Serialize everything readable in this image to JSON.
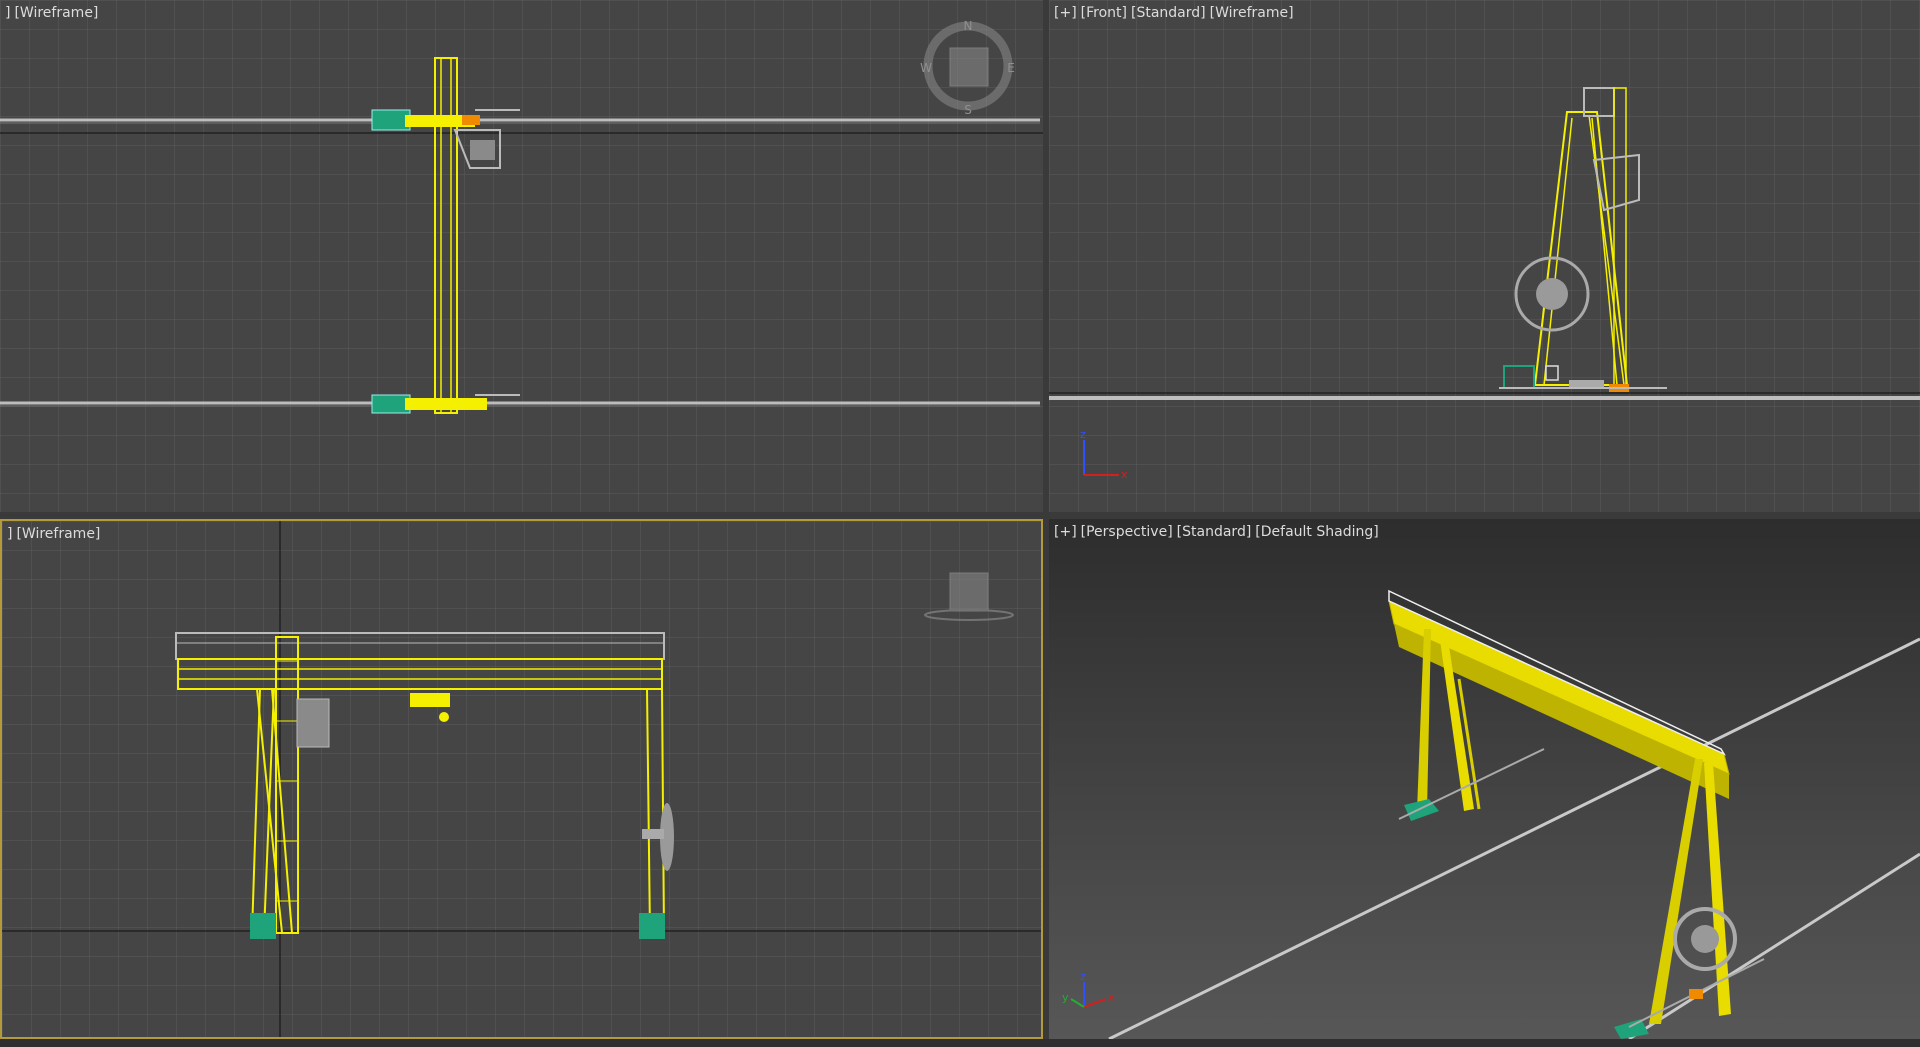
{
  "viewports": [
    {
      "id": "top",
      "label_items": [
        "]",
        "[Wireframe]"
      ],
      "compass": {
        "n": "N",
        "s": "S",
        "w": "W",
        "e": "E"
      }
    },
    {
      "id": "front",
      "label_items": [
        "[+]",
        "[Front]",
        "[Standard]",
        "[Wireframe]"
      ],
      "axis": {
        "x": "x",
        "z": "z"
      }
    },
    {
      "id": "left",
      "label_items": [
        "]",
        "[Wireframe]"
      ]
    },
    {
      "id": "perspective",
      "label_items": [
        "[+]",
        "[Perspective]",
        "[Standard]",
        "[Default Shading]"
      ],
      "axis": {
        "x": "x",
        "y": "y",
        "z": "z"
      }
    }
  ],
  "colors": {
    "grid": "#5a5a5a",
    "grid_major": "#2a2a2a",
    "crane_yellow": "#f4f000",
    "rail": "#b8b8b8",
    "motor_green": "#1fa37a",
    "active_border": "#b49a3a"
  }
}
